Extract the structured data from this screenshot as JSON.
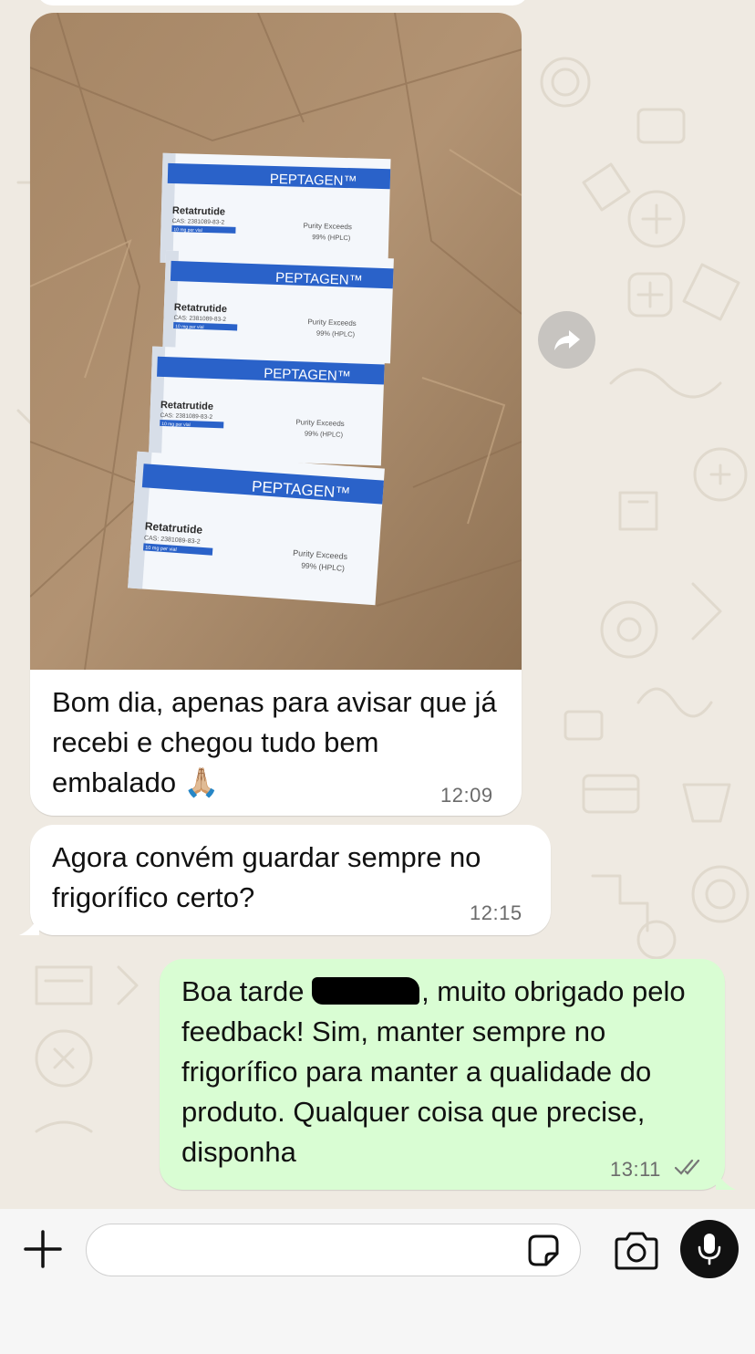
{
  "chat": {
    "image_message": {
      "photo_alt": "Photo of four Peptagen boxes on brown paper",
      "box_label": {
        "brand": "PEPTAGEN™",
        "product": "Retatrutide",
        "cas": "CAS: 2381089-83-2",
        "dose": "10 mg per vial",
        "purity_line1": "Purity Exceeds",
        "purity_line2": "99% (HPLC)"
      },
      "caption": "Bom dia, apenas para avisar que já recebi e chegou tudo bem embalado 🙏🏼",
      "time": "12:09"
    },
    "incoming_message": {
      "text": "Agora convém guardar sempre no frigorífico certo?",
      "time": "12:15"
    },
    "outgoing_message": {
      "text_start": "Boa tarde",
      "text_rest": ", muito obrigado pelo feedback! Sim, manter sempre no frigorífico para manter a qualidade do produto. Qualquer coisa que precise, disponha",
      "time": "13:11",
      "status": "read"
    }
  },
  "input_bar": {
    "message_value": "",
    "icons": [
      "plus-icon",
      "sticker-icon",
      "camera-icon",
      "microphone-icon"
    ]
  },
  "colors": {
    "background": "#efeae2",
    "incoming_bubble": "#ffffff",
    "outgoing_bubble": "#d9fdd3",
    "brand_blue": "#2a62c9"
  }
}
